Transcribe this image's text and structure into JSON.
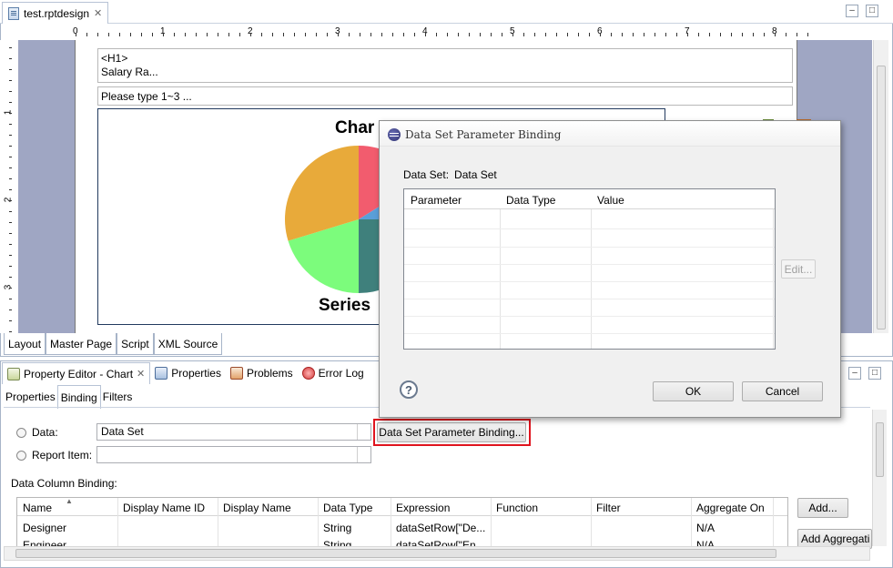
{
  "editor": {
    "file_tab": "test.rptdesign",
    "ruler_numbers": [
      "0",
      "1",
      "2",
      "3",
      "4",
      "5",
      "6",
      "7",
      "8"
    ],
    "vruler_numbers": [
      "1",
      "2",
      "3"
    ],
    "report_items": {
      "heading_tag": "<H1>",
      "heading_text": "Salary Ra...",
      "text_prompt": "Please type 1~3 ...",
      "chart_title_partial": "Char",
      "series_label_partial": "Series"
    },
    "layout_tabs": [
      "Layout",
      "Master Page",
      "Script",
      "XML Source"
    ]
  },
  "chart_data": {
    "type": "pie",
    "title": "Char",
    "slices": [
      {
        "color": "#F25C6E"
      },
      {
        "color": "#5A9FD8"
      },
      {
        "color": "#3F807C"
      },
      {
        "color": "#7CFC7C"
      },
      {
        "color": "#E8AA3A"
      }
    ]
  },
  "views": {
    "tabs": [
      {
        "label": "Property Editor - Chart",
        "icon": "property-editor-icon",
        "active": true
      },
      {
        "label": "Properties",
        "icon": "properties-icon"
      },
      {
        "label": "Problems",
        "icon": "problems-icon"
      },
      {
        "label": "Error Log",
        "icon": "error-log-icon"
      }
    ],
    "sub_tabs": [
      "Properties",
      "Binding",
      "Filters"
    ],
    "data_label": "Data:",
    "data_value": "Data Set",
    "report_item_label": "Report Item:",
    "report_item_value": "",
    "param_binding_button": "Data Set Parameter Binding...",
    "data_column_binding_label": "Data Column Binding:",
    "table": {
      "columns": [
        "Name",
        "Display Name ID",
        "Display Name",
        "Data Type",
        "Expression",
        "Function",
        "Filter",
        "Aggregate On"
      ],
      "rows": [
        [
          "Designer",
          "",
          "",
          "String",
          "dataSetRow[\"De...",
          "",
          "",
          "N/A"
        ],
        [
          "Engineer",
          "",
          "",
          "String",
          "dataSetRow[\"En...",
          "",
          "",
          "N/A"
        ]
      ]
    },
    "add_button": "Add...",
    "add_aggregation_button": "Add Aggregati"
  },
  "dialog": {
    "title": "Data Set Parameter Binding",
    "data_set_label": "Data Set:",
    "data_set_value": "Data Set",
    "columns": [
      "Parameter",
      "Data Type",
      "Value"
    ],
    "edit_button": "Edit...",
    "ok_button": "OK",
    "cancel_button": "Cancel",
    "help_glyph": "?"
  }
}
